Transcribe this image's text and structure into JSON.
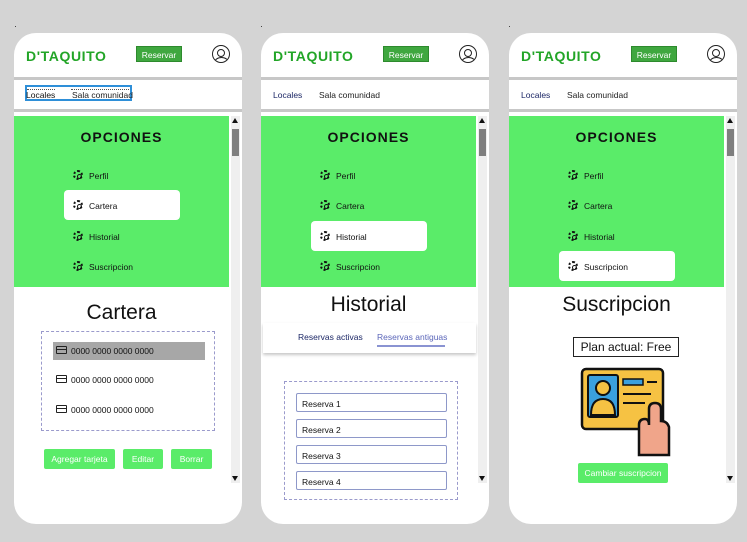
{
  "app": {
    "brand": "D'TAQUITO",
    "reserve_button": "Reservar"
  },
  "nav": {
    "locales": "Locales",
    "sala": "Sala comunidad"
  },
  "menu": {
    "heading": "OPCIONES",
    "items": [
      "Perfil",
      "Cartera",
      "Historial",
      "Suscripcion"
    ]
  },
  "screens": {
    "cartera": {
      "title": "Cartera",
      "cards": [
        "0000 0000 0000 0000",
        "0000 0000 0000 0000",
        "0000 0000 0000 0000"
      ],
      "buttons": {
        "add": "Agregar tarjeta",
        "edit": "Editar",
        "delete": "Borrar"
      }
    },
    "historial": {
      "title": "Historial",
      "tabs": [
        "Reservas activas",
        "Reservas antiguas"
      ],
      "reservations": [
        "Reserva 1",
        "Reserva 2",
        "Reserva 3",
        "Reserva 4"
      ]
    },
    "suscripcion": {
      "title": "Suscripcion",
      "plan": "Plan actual: Free",
      "change_button": "Cambiar suscripcion"
    }
  },
  "colors": {
    "brand": "#22a527",
    "menu_bg": "#5aec69",
    "reserve_button": "#3fa73f",
    "selection_box": "#2e8fd8",
    "background": "#d4d4d4"
  },
  "icons": {
    "profile": "user-circle-icon",
    "menu_item": "gear-icon",
    "card": "credit-card-icon",
    "scroll_up": "arrow-up-icon",
    "scroll_down": "arrow-down-icon",
    "membership": "id-card-hand-icon"
  }
}
